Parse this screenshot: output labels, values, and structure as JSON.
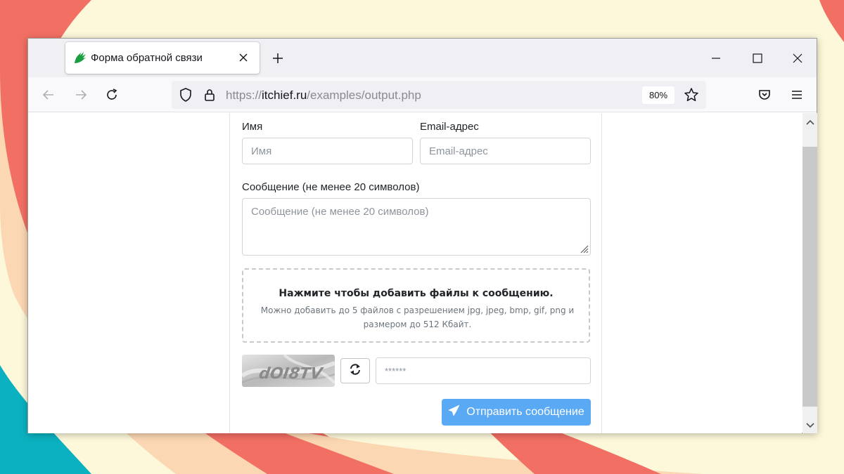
{
  "tab": {
    "title": "Форма обратной связи",
    "favicon": "itchief-hand-icon",
    "close_glyph": "✕"
  },
  "navbar": {
    "url_scheme": "https://",
    "url_host": "itchief.ru",
    "url_path": "/examples/output.php",
    "zoom": "80%"
  },
  "form": {
    "name_label": "Имя",
    "name_placeholder": "Имя",
    "email_label": "Email-адрес",
    "email_placeholder": "Email-адрес",
    "message_label": "Сообщение (не менее 20 символов)",
    "message_placeholder": "Сообщение (не менее 20 символов)",
    "dropzone_title": "Нажмите чтобы добавить файлы к сообщению.",
    "dropzone_hint": "Можно добавить до 5 файлов с разрешением jpg, jpeg, bmp, gif, png и размером до 512 Кбайт.",
    "captcha_text": "dOI8TV",
    "captcha_placeholder": "******",
    "submit_label": "Отправить сообщение"
  },
  "colors": {
    "submit_bg": "#5aa9f4",
    "accent_green": "#1a9e3f"
  }
}
